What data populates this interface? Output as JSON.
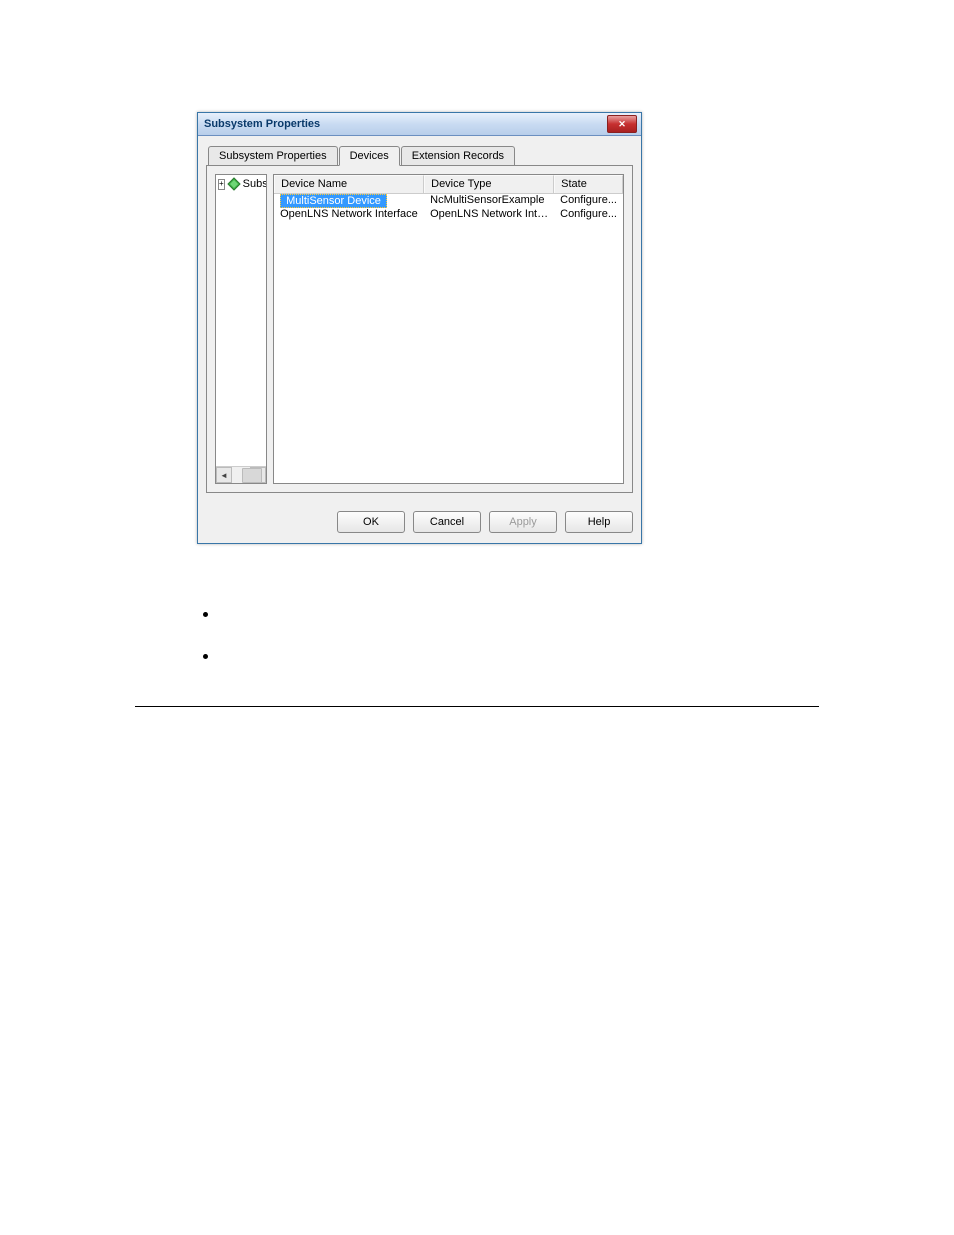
{
  "dialog": {
    "title": "Subsystem Properties",
    "tabs": {
      "subsystem_properties": "Subsystem Properties",
      "devices": "Devices",
      "extension_records": "Extension Records"
    },
    "tree": {
      "root_label": "Subsyste"
    },
    "columns": {
      "name": "Device Name",
      "type": "Device Type",
      "state": "State"
    },
    "rows": [
      {
        "name": "MultiSensor Device",
        "type": "NcMultiSensorExample",
        "state": "Configure..."
      },
      {
        "name": "OpenLNS Network Interface",
        "type": "OpenLNS Network Interf...",
        "state": "Configure..."
      }
    ],
    "buttons": {
      "ok": "OK",
      "cancel": "Cancel",
      "apply": "Apply",
      "help": "Help"
    }
  }
}
